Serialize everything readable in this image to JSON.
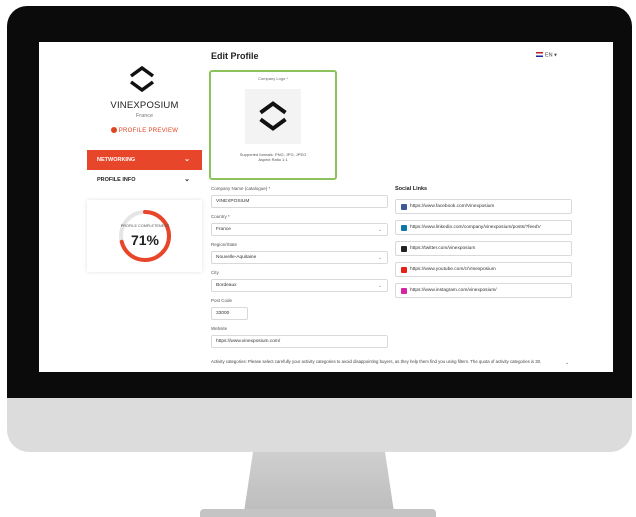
{
  "sidebar": {
    "company_name": "VINEXPOSIUM",
    "country": "France",
    "preview_label": "PROFILE PREVIEW",
    "nav": [
      {
        "label": "NETWORKING",
        "active": true
      },
      {
        "label": "PROFILE INFO",
        "active": false
      }
    ],
    "completeness": {
      "label": "PROFILE COMPLETENESS",
      "value": 71,
      "display": "71%"
    }
  },
  "header": {
    "title": "Edit Profile",
    "language": "EN",
    "language_caret": "▾"
  },
  "logo_upload": {
    "label": "Company Logo *",
    "formats": "Supported formats: PNG, JPG, JPEG",
    "aspect": "Aspect Ratio 1:1"
  },
  "form": {
    "company_name": {
      "label": "Company Name (catalogue) *",
      "value": "VINEXPOSIUM"
    },
    "country": {
      "label": "Country *",
      "value": "France"
    },
    "region": {
      "label": "Region/State",
      "value": "Nouvelle-Aquitaine"
    },
    "city": {
      "label": "City",
      "value": "Bordeaux"
    },
    "postcode": {
      "label": "Post Code",
      "value": "33000"
    },
    "website": {
      "label": "Website",
      "value": "https://www.vinexposium.com/"
    },
    "activity_note": "Activity categories: Please select carefully your activity categories to avoid disappointing buyers, as they help them find you using filters. The quota of activity categories is 30."
  },
  "social": {
    "title": "Social Links",
    "links": [
      {
        "icon": "facebook-icon",
        "color": "#3b5998",
        "url": "https://www.facebook.com/Vinexposium"
      },
      {
        "icon": "linkedin-icon",
        "color": "#0e76a8",
        "url": "https://www.linkedin.com/company/vinexposium/posts/?feedV"
      },
      {
        "icon": "twitter-icon",
        "color": "#222222",
        "url": "https://twitter.com/vinexposium"
      },
      {
        "icon": "youtube-icon",
        "color": "#e62117",
        "url": "https://www.youtube.com/c/Vinexposium"
      },
      {
        "icon": "instagram-icon",
        "color": "#d6249f",
        "url": "https://www.instagram.com/vinexposium/"
      }
    ]
  },
  "colors": {
    "accent": "#e8462a",
    "highlight": "#8cc15c"
  }
}
